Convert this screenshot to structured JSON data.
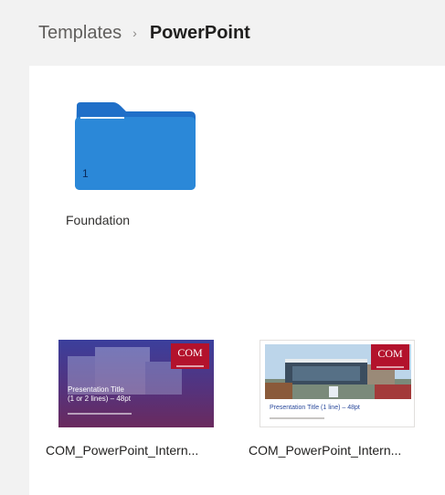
{
  "breadcrumb": {
    "parent": "Templates",
    "separator": "›",
    "current": "PowerPoint"
  },
  "folder": {
    "name": "Foundation",
    "item_count": "1",
    "icon": "folder-icon",
    "color": "#2b88d8"
  },
  "files": [
    {
      "name": "COM_PowerPoint_Intern...",
      "thumbnail": {
        "logo": "COM",
        "title_line1": "Presentation Title",
        "title_line2": "(1 or 2 lines) – 48pt"
      }
    },
    {
      "name": "COM_PowerPoint_Intern...",
      "thumbnail": {
        "logo": "COM",
        "title_line1": "Presentation Title (1 line) – 48pt"
      }
    }
  ],
  "colors": {
    "background": "#f2f2f2",
    "panel": "#ffffff",
    "logo_red": "#b3122c"
  }
}
